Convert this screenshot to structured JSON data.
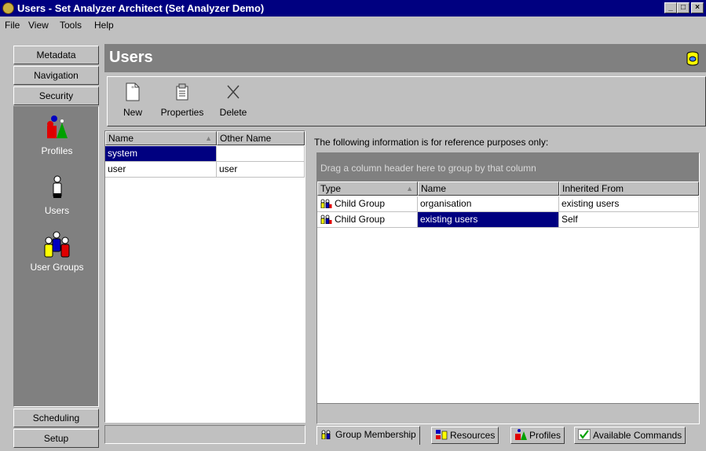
{
  "window": {
    "title": "Users - Set Analyzer Architect (Set Analyzer Demo)",
    "controls": [
      "_",
      "□",
      "×"
    ]
  },
  "menu": [
    {
      "label": "File"
    },
    {
      "label": "View"
    },
    {
      "label": "Tools"
    },
    {
      "label": "Help"
    }
  ],
  "nav": {
    "top_buttons": [
      "Metadata",
      "Navigation",
      "Security"
    ],
    "items": [
      {
        "label": "Profiles",
        "icon": "profiles-icon"
      },
      {
        "label": "Users",
        "icon": "user-icon"
      },
      {
        "label": "User Groups",
        "icon": "user-groups-icon"
      }
    ],
    "bottom_buttons": [
      "Scheduling",
      "Setup"
    ]
  },
  "header": {
    "title": "Users",
    "icon": "database-icon"
  },
  "toolbar": {
    "new": "New",
    "properties": "Properties",
    "delete": "Delete"
  },
  "userlist": {
    "columns": [
      "Name",
      "Other Name"
    ],
    "rows": [
      {
        "name": "system",
        "other": "",
        "selected": true
      },
      {
        "name": "user",
        "other": "user",
        "selected": false
      }
    ]
  },
  "info": {
    "note": "The following information is for reference purposes only:",
    "group_hint": "Drag a column header here to group by that column",
    "columns": [
      "Type",
      "Name",
      "Inherited From"
    ],
    "rows": [
      {
        "type": "Child Group",
        "name": "organisation",
        "inherited": "existing users",
        "selected": false
      },
      {
        "type": "Child Group",
        "name": "existing users",
        "inherited": "Self",
        "selected": true
      }
    ]
  },
  "tabs": [
    {
      "label": "Group Membership",
      "active": true
    },
    {
      "label": "Resources",
      "active": false
    },
    {
      "label": "Profiles",
      "active": false
    },
    {
      "label": "Available Commands",
      "active": false
    }
  ],
  "colors": {
    "titlebar": "#000080",
    "selection": "#000080",
    "panel": "#808080",
    "face": "#c0c0c0"
  }
}
